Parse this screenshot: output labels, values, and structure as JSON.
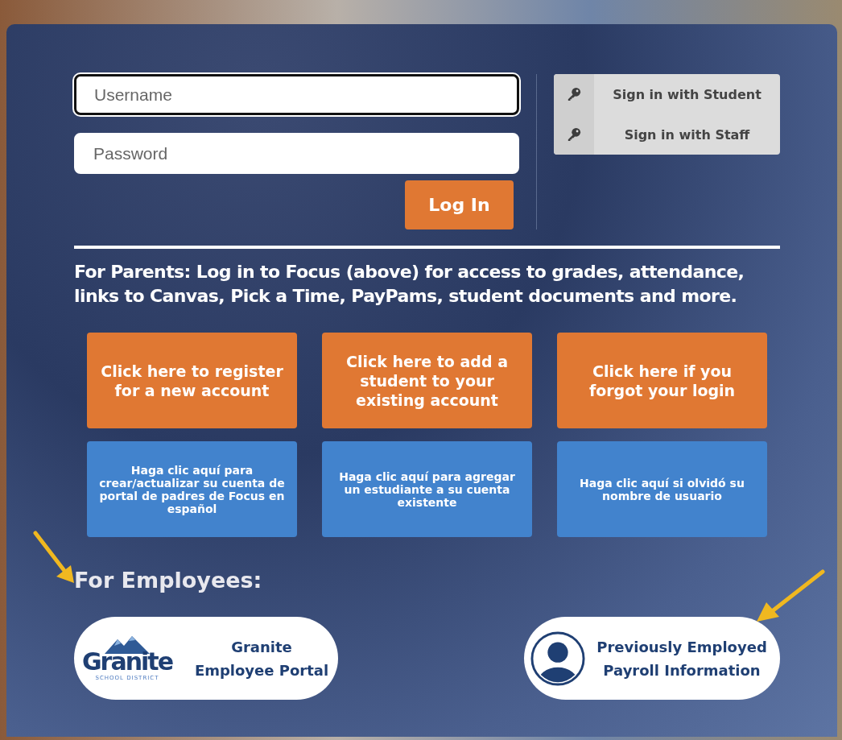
{
  "login": {
    "username": {
      "placeholder": "Username",
      "focused": true
    },
    "password": {
      "placeholder": "Password"
    },
    "submit": "Log In"
  },
  "sso": [
    {
      "label": "Sign in with Student"
    },
    {
      "label": "Sign in with Staff"
    }
  ],
  "parents_notice": "For Parents: Log in to Focus (above) for access to grades, attendance, links to Canvas, Pick a Time, PayPams, student documents and more.",
  "english_links": [
    {
      "label": "Click here to register for a new account"
    },
    {
      "label": "Click here to add a student to your existing account"
    },
    {
      "label": "Click here if you forgot your login"
    }
  ],
  "spanish_links": [
    {
      "label": "Haga clic aquí para crear/actualizar su cuenta de portal de padres de Focus en español"
    },
    {
      "label": "Haga clic aquí para agregar un estudiante a su cuenta existente"
    },
    {
      "label": "Haga clic aquí si olvidó su nombre de usuario"
    }
  ],
  "employees": {
    "heading": "For Employees:",
    "portal": {
      "logo_name": "Granite",
      "logo_sub": "SCHOOL DISTRICT",
      "label": "Granite Employee Portal"
    },
    "payroll": {
      "label": "Previously Employed Payroll Information"
    }
  }
}
